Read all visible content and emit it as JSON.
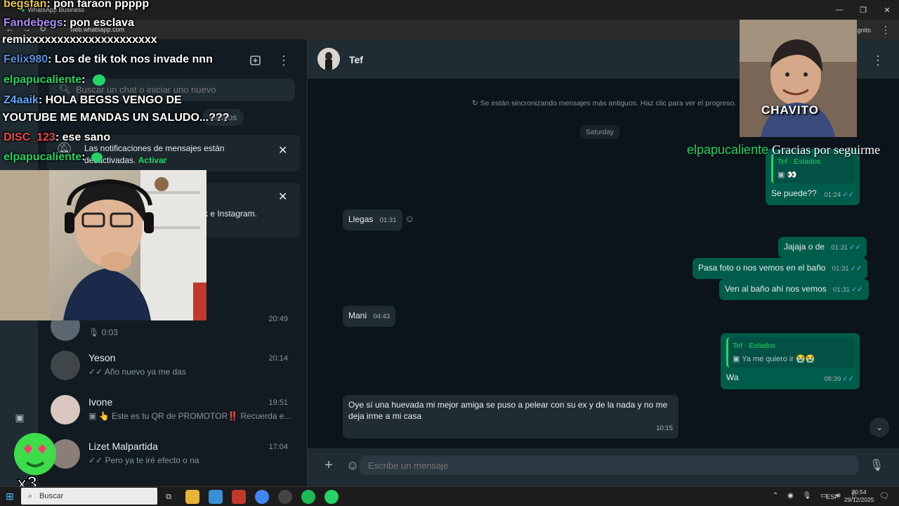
{
  "browser": {
    "tab_title": "WhatsApp Business",
    "url": "web.whatsapp.com",
    "incognito_label": "Incógnito"
  },
  "sidebar": {
    "search_placeholder": "Buscar un chat o iniciar uno nuevo",
    "chip_grupos": "Grupos",
    "notification": {
      "text": "Las notificaciones de mensajes están desactivadas.",
      "action": "Activar"
    },
    "promo_text": "k e Instagram.",
    "chats": [
      {
        "name": "",
        "time": "20:49",
        "preview": "0:03",
        "icon": "mic-icon"
      },
      {
        "name": "Yeson",
        "time": "20:14",
        "preview": "Año nuevo ya me das",
        "icon": "double-check-icon"
      },
      {
        "name": "Ivone",
        "time": "19:51",
        "preview": "👆 Este es tu QR de PROMOTOR‼️ Recuerda e...",
        "icon": "image-icon"
      },
      {
        "name": "Lizet Malpartida",
        "time": "17:04",
        "preview": "Pero ya te iré efecto o na",
        "icon": "double-check-icon"
      }
    ]
  },
  "chat": {
    "contact_name": "Tef",
    "sync_note": "Se están sincronizando mensajes más antiguos. Haz clic para ver el progreso.",
    "day_label": "Saturday",
    "messages": {
      "m1_quote_title": "Tef · Estados",
      "m1_quote_body": "👀",
      "m1_text": "Se puede??",
      "m1_time": "01:24",
      "m2_text": "Llegas",
      "m2_time": "01:31",
      "m3_text": "Jajaja o de",
      "m3_time": "01:31",
      "m4_text": "Pasa foto o nos vemos en el baño",
      "m4_time": "01:31",
      "m5_text": "Ven al baño ahí nos vemos",
      "m5_time": "01:31",
      "m6_text": "Mani",
      "m6_time": "04:43",
      "m7_quote_title": "Tef · Estados",
      "m7_quote_body": "Ya me quiero ir 😭😭",
      "m7_text": "Wa",
      "m7_time": "08:39",
      "m8_text": "Oye sí una huevada mi mejor amiga se puso a pelear con su ex y de la nada y no me deja irme a mi casa",
      "m8_time": "10:15"
    },
    "composer_placeholder": "Escribe un mensaje"
  },
  "stream_overlay": {
    "lines": [
      {
        "user": "begsfan",
        "msg": ": pon faraon ppppp",
        "color": "#e6c84a"
      },
      {
        "user": "Fandebegs",
        "msg": ": pon esclava",
        "color": "#a98cf0"
      },
      {
        "user": "",
        "msg": "remixxxxxxxxxxxxxxxxxxxxx",
        "color": "#ffffff"
      },
      {
        "user": "Felix980",
        "msg": ": Los de tik tok nos invade nnn",
        "color": "#5b8fe0"
      },
      {
        "user": "elpapucaliente",
        "msg": ":",
        "color": "#25d366"
      },
      {
        "user": "Z4aaik",
        "msg": ": HOLA BEGSS VENGO DE",
        "color": "#5fa8ff"
      },
      {
        "user": "",
        "msg": "YOUTUBE ME MANDAS UN SALUDO...???",
        "color": "#ffffff"
      },
      {
        "user": "DISC_123",
        "msg": ": ese sano",
        "color": "#e84a4a"
      },
      {
        "user": "elpapucaliente",
        "msg": ":",
        "color": "#25d366"
      }
    ],
    "thanks_user": "elpapucaliente",
    "thanks_msg": "Gracias por seguirme",
    "guest_caption": "CHAVITO",
    "sticker_label": "x3"
  },
  "taskbar": {
    "search_label": "Buscar",
    "lang": "ESP",
    "time": "20:54",
    "date": "29/12/2025"
  },
  "colors": {
    "wa_green": "#25d366",
    "out_bubble": "#005c4b",
    "in_bubble": "#202c33",
    "chat_bg": "#0b141a"
  }
}
